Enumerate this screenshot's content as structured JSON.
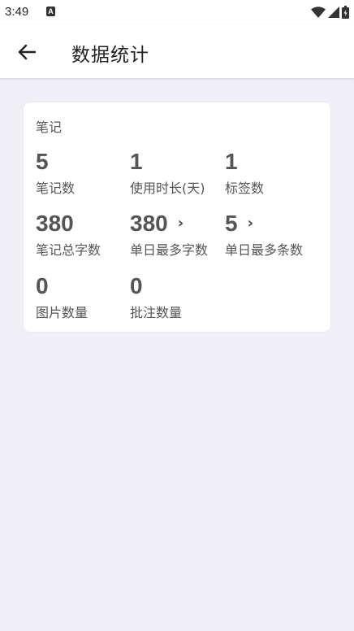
{
  "status_bar": {
    "time": "3:49",
    "a_icon_letter": "A"
  },
  "app_bar": {
    "title": "数据统计"
  },
  "card": {
    "heading": "笔记",
    "stats": [
      {
        "value": "5",
        "label": "笔记数"
      },
      {
        "value": "1",
        "label": "使用时长(天)"
      },
      {
        "value": "1",
        "label": "标签数"
      },
      {
        "value": "380",
        "label": "笔记总字数"
      },
      {
        "value": "380",
        "label": "单日最多字数"
      },
      {
        "value": "5",
        "label": "单日最多条数"
      },
      {
        "value": "0",
        "label": "图片数量"
      },
      {
        "value": "0",
        "label": "批注数量"
      }
    ]
  }
}
